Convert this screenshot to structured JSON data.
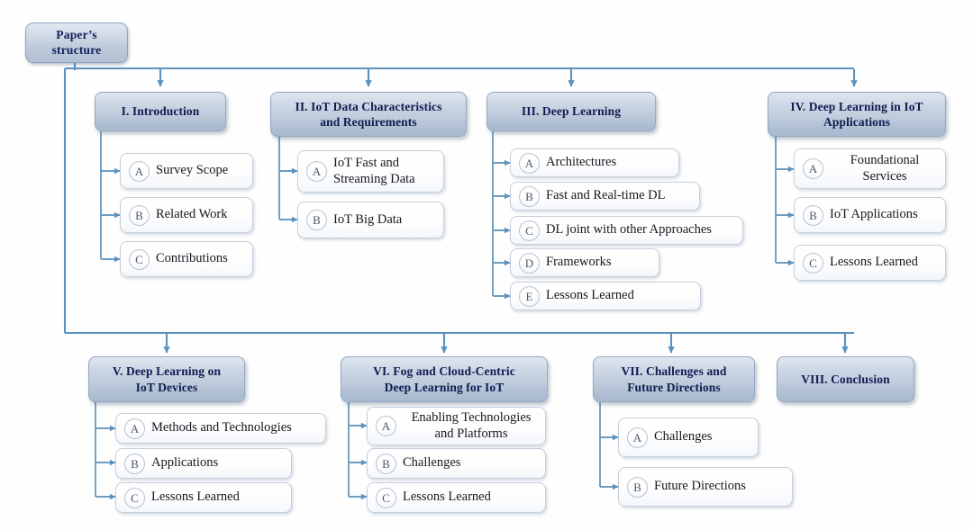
{
  "diagram": {
    "title": "Paper's structure",
    "root": {
      "label": "Paper’s\nstructure"
    },
    "colors": {
      "header_fill_top": "#dfe6f0",
      "header_fill_bottom": "#a9b9cf",
      "header_border": "#93a8c0",
      "header_text": "#101c52",
      "leaf_fill": "#ffffff",
      "leaf_border": "#c4cfdb",
      "leaf_text": "#15181d",
      "letter_circle_border": "#b7c3d1",
      "letter_text": "#4e5a69",
      "connector": "#5b92c0",
      "background": "#ffffff"
    },
    "sections": [
      {
        "id": "section-i",
        "title": "I. Introduction",
        "items": [
          {
            "letter": "A",
            "label": "Survey Scope",
            "align": "left"
          },
          {
            "letter": "B",
            "label": "Related Work",
            "align": "left"
          },
          {
            "letter": "C",
            "label": "Contributions",
            "align": "left"
          }
        ]
      },
      {
        "id": "section-ii",
        "title": "II. IoT Data Characteristics\nand Requirements",
        "items": [
          {
            "letter": "A",
            "label": "IoT Fast and\nStreaming Data",
            "align": "left"
          },
          {
            "letter": "B",
            "label": "IoT Big Data",
            "align": "left"
          }
        ]
      },
      {
        "id": "section-iii",
        "title": "III. Deep Learning",
        "items": [
          {
            "letter": "A",
            "label": "Architectures",
            "align": "left"
          },
          {
            "letter": "B",
            "label": "Fast and Real-time DL",
            "align": "left"
          },
          {
            "letter": "C",
            "label": "DL joint with other Approaches",
            "align": "left"
          },
          {
            "letter": "D",
            "label": "Frameworks",
            "align": "left"
          },
          {
            "letter": "E",
            "label": "Lessons Learned",
            "align": "left"
          }
        ]
      },
      {
        "id": "section-iv",
        "title": "IV. Deep Learning in IoT\nApplications",
        "items": [
          {
            "letter": "A",
            "label": "Foundational\nServices",
            "align": "center"
          },
          {
            "letter": "B",
            "label": "IoT Applications",
            "align": "left"
          },
          {
            "letter": "C",
            "label": "Lessons Learned",
            "align": "left"
          }
        ]
      },
      {
        "id": "section-v",
        "title": "V. Deep Learning on\nIoT Devices",
        "items": [
          {
            "letter": "A",
            "label": "Methods and Technologies",
            "align": "left"
          },
          {
            "letter": "B",
            "label": "Applications",
            "align": "left"
          },
          {
            "letter": "C",
            "label": "Lessons Learned",
            "align": "left"
          }
        ]
      },
      {
        "id": "section-vi",
        "title": "VI. Fog and Cloud-Centric\nDeep Learning for IoT",
        "items": [
          {
            "letter": "A",
            "label": "Enabling Technologies\nand Platforms",
            "align": "center"
          },
          {
            "letter": "B",
            "label": "Challenges",
            "align": "left"
          },
          {
            "letter": "C",
            "label": "Lessons Learned",
            "align": "left"
          }
        ]
      },
      {
        "id": "section-vii",
        "title": "VII. Challenges and\nFuture Directions",
        "items": [
          {
            "letter": "A",
            "label": "Challenges",
            "align": "left"
          },
          {
            "letter": "B",
            "label": "Future Directions",
            "align": "left"
          }
        ]
      },
      {
        "id": "section-viii",
        "title": "VIII. Conclusion",
        "items": []
      }
    ]
  }
}
